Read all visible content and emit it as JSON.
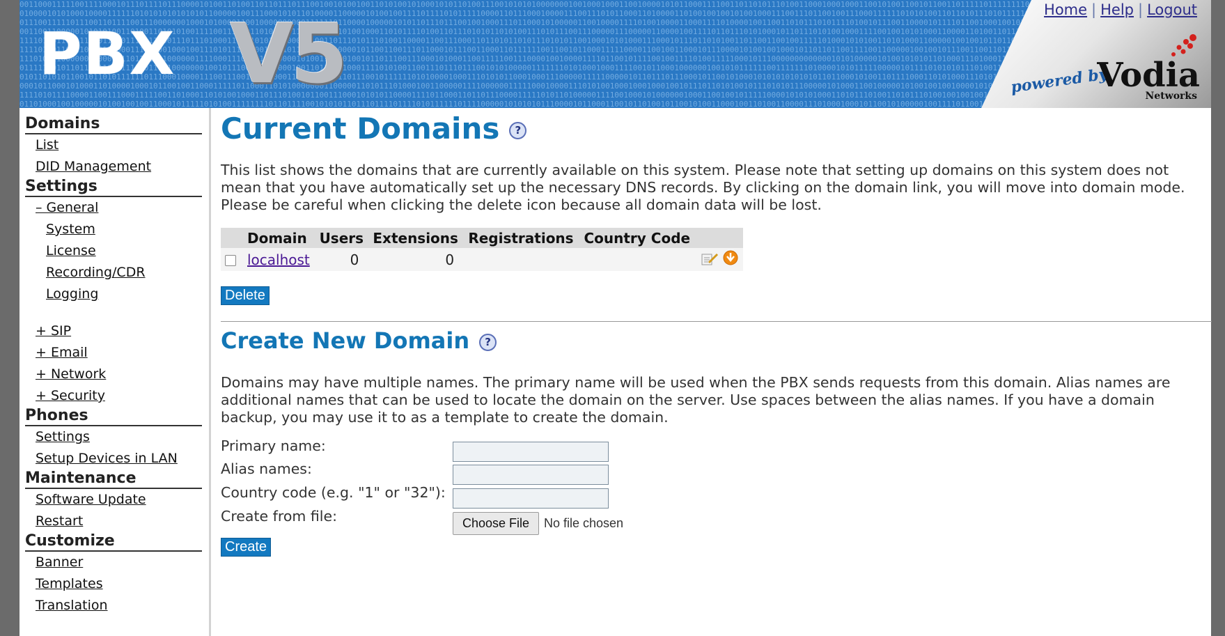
{
  "banner": {
    "logo_pbx": "PBX",
    "logo_v5": "V5",
    "powered_by": "powered by",
    "brand": "Vodia",
    "brand_sub": "Networks",
    "links": {
      "home": "Home",
      "help": "Help",
      "logout": "Logout",
      "separator": "|"
    }
  },
  "sidebar": {
    "domains": {
      "title": "Domains",
      "items": [
        "List",
        "DID Management"
      ]
    },
    "settings": {
      "title": "Settings",
      "general": "– General",
      "general_items": [
        "System",
        "License",
        "Recording/CDR",
        "Logging"
      ],
      "collapsed": [
        "+ SIP",
        "+ Email",
        "+ Network",
        "+ Security"
      ]
    },
    "phones": {
      "title": "Phones",
      "items": [
        "Settings",
        "Setup Devices in LAN"
      ]
    },
    "maintenance": {
      "title": "Maintenance",
      "items": [
        "Software Update",
        "Restart"
      ]
    },
    "customize": {
      "title": "Customize",
      "items": [
        "Banner",
        "Templates",
        "Translation"
      ]
    }
  },
  "main": {
    "current": {
      "title": "Current Domains",
      "help": "?",
      "description": "This list shows the domains that are currently available on this system. Please note that setting up domains on this system does not mean that you have automatically set up the necessary DNS records. By clicking on the domain link, you will move into domain mode. Please be careful when clicking the delete icon because all domain data will be lost.",
      "columns": [
        "Domain",
        "Users",
        "Extensions",
        "Registrations",
        "Country Code"
      ],
      "rows": [
        {
          "domain": "localhost",
          "users": "0",
          "extensions": "0",
          "registrations": "",
          "country_code": ""
        }
      ],
      "delete_label": "Delete"
    },
    "create": {
      "title": "Create New Domain",
      "help": "?",
      "description": "Domains may have multiple names. The primary name will be used when the PBX sends requests from this domain. Alias names are additional names that can be used to locate the domain on the server. Use spaces between the alias names. If you have a domain backup, you may use it to as a template to create the domain.",
      "primary_label": "Primary name:",
      "alias_label": "Alias names:",
      "country_label": "Country code (e.g. \"1\" or \"32\"):",
      "file_label": "Create from file:",
      "choose_file": "Choose File",
      "no_file": "No file chosen",
      "create_label": "Create"
    }
  }
}
